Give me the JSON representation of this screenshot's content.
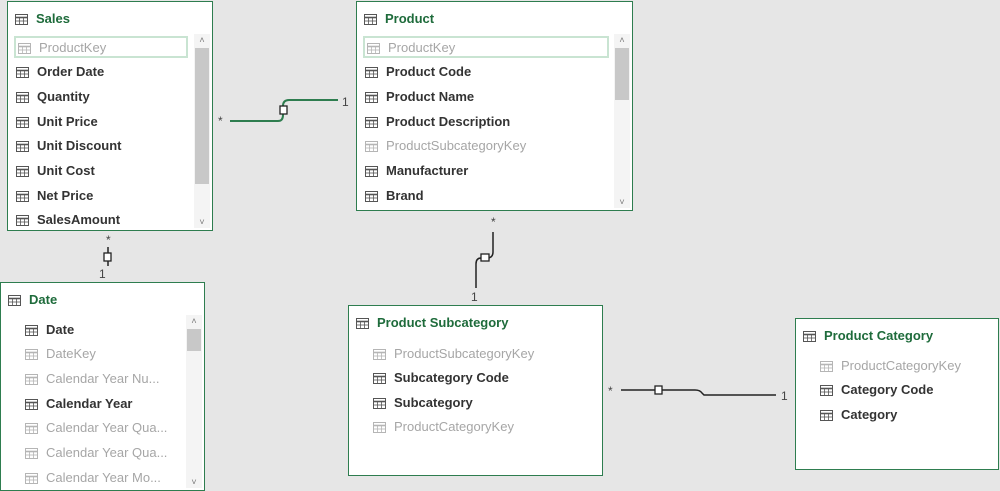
{
  "tables": {
    "sales": {
      "title": "Sales",
      "fields": [
        {
          "label": "ProductKey",
          "hidden": true,
          "selected": true
        },
        {
          "label": "Order Date",
          "hidden": false
        },
        {
          "label": "Quantity",
          "hidden": false
        },
        {
          "label": "Unit Price",
          "hidden": false
        },
        {
          "label": "Unit Discount",
          "hidden": false
        },
        {
          "label": "Unit Cost",
          "hidden": false
        },
        {
          "label": "Net Price",
          "hidden": false
        },
        {
          "label": "SalesAmount",
          "hidden": false
        }
      ]
    },
    "product": {
      "title": "Product",
      "fields": [
        {
          "label": "ProductKey",
          "hidden": true,
          "selected": true
        },
        {
          "label": "Product Code",
          "hidden": false
        },
        {
          "label": "Product Name",
          "hidden": false
        },
        {
          "label": "Product Description",
          "hidden": false
        },
        {
          "label": "ProductSubcategoryKey",
          "hidden": true
        },
        {
          "label": "Manufacturer",
          "hidden": false
        },
        {
          "label": "Brand",
          "hidden": false
        }
      ]
    },
    "date": {
      "title": "Date",
      "fields": [
        {
          "label": "Date",
          "hidden": false
        },
        {
          "label": "DateKey",
          "hidden": true
        },
        {
          "label": "Calendar Year Nu...",
          "hidden": true
        },
        {
          "label": "Calendar Year",
          "hidden": false
        },
        {
          "label": "Calendar Year Qua...",
          "hidden": true
        },
        {
          "label": "Calendar Year Qua...",
          "hidden": true
        },
        {
          "label": "Calendar Year Mo...",
          "hidden": true
        }
      ]
    },
    "product_subcategory": {
      "title": "Product Subcategory",
      "fields": [
        {
          "label": "ProductSubcategoryKey",
          "hidden": true
        },
        {
          "label": "Subcategory Code",
          "hidden": false
        },
        {
          "label": "Subcategory",
          "hidden": false
        },
        {
          "label": "ProductCategoryKey",
          "hidden": true
        }
      ]
    },
    "product_category": {
      "title": "Product Category",
      "fields": [
        {
          "label": "ProductCategoryKey",
          "hidden": true
        },
        {
          "label": "Category Code",
          "hidden": false
        },
        {
          "label": "Category",
          "hidden": false
        }
      ]
    }
  },
  "relationships": {
    "sales_product": {
      "many": "*",
      "one": "1"
    },
    "sales_date": {
      "many": "*",
      "one": "1"
    },
    "product_subcategory": {
      "many": "*",
      "one": "1"
    },
    "subcategory_category": {
      "many": "*",
      "one": "1"
    }
  },
  "colors": {
    "accent": "#1e6b3b",
    "border": "#2e7d4f",
    "line": "#2e7d4f",
    "hidden_text": "#a6a6a6",
    "background": "#e6e6e6"
  },
  "icons": {
    "table": "table-icon",
    "field": "field-icon",
    "scroll_up": "chevron-up-icon",
    "scroll_down": "chevron-down-icon"
  }
}
